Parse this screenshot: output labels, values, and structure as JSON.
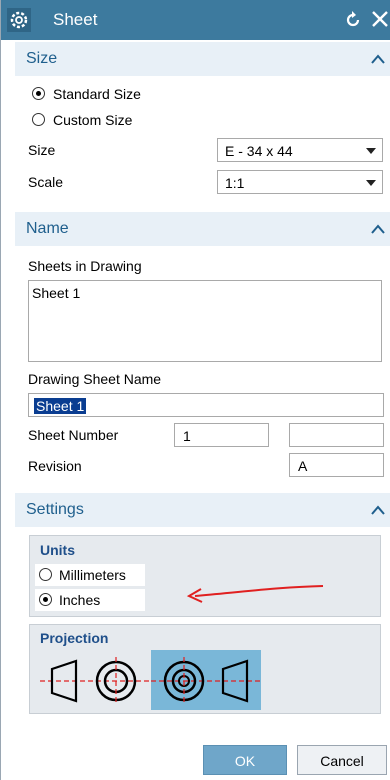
{
  "window": {
    "title": "Sheet"
  },
  "size_group": {
    "header": "Size",
    "options": [
      {
        "label": "Standard Size",
        "selected": true
      },
      {
        "label": "Custom Size",
        "selected": false
      }
    ],
    "size_label": "Size",
    "size_value": "E - 34 x 44",
    "scale_label": "Scale",
    "scale_value": "1:1"
  },
  "name_group": {
    "header": "Name",
    "sheets_label": "Sheets in Drawing",
    "sheets": [
      "Sheet 1"
    ],
    "sheet_name_label": "Drawing Sheet Name",
    "sheet_name_value": "Sheet 1",
    "sheet_number_label": "Sheet Number",
    "sheet_number_value": "1",
    "sheet_number_extra": "",
    "revision_label": "Revision",
    "revision_value": "A"
  },
  "settings_group": {
    "header": "Settings",
    "units_title": "Units",
    "units": [
      {
        "label": "Millimeters",
        "selected": false
      },
      {
        "label": "Inches",
        "selected": true
      }
    ],
    "projection_title": "Projection",
    "projection_options": [
      "first-angle",
      "third-angle"
    ],
    "projection_selected": "third-angle"
  },
  "buttons": {
    "ok": "OK",
    "cancel": "Cancel"
  },
  "colors": {
    "titlebar": "#3d7a9e",
    "header_text": "#1f5f8d",
    "selection": "#0a3d91",
    "annotation_arrow": "#e02020",
    "ok_button": "#6fa6c9"
  }
}
